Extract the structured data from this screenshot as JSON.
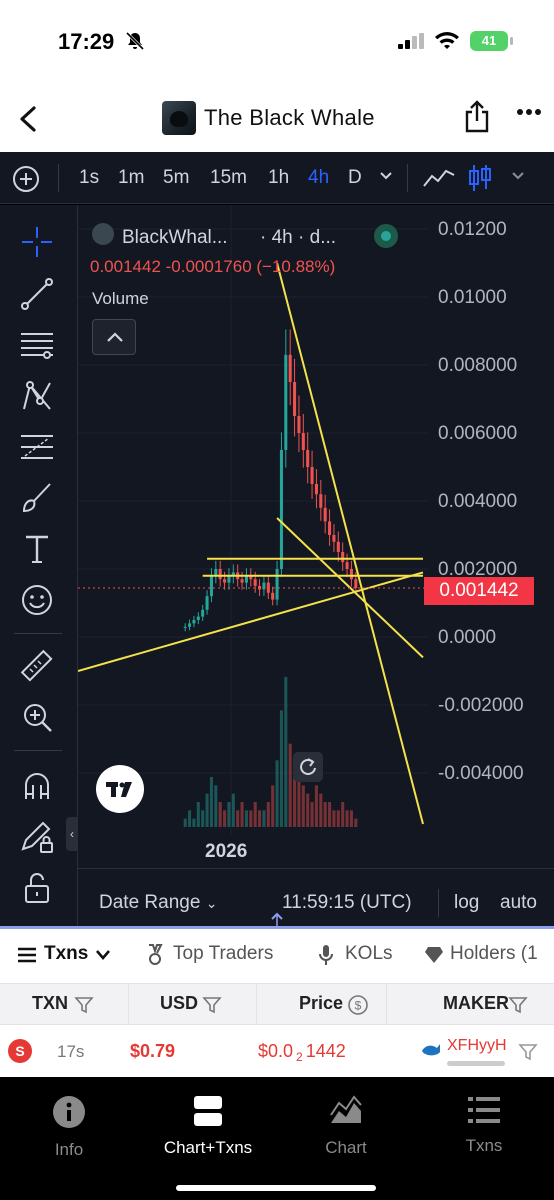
{
  "status_bar": {
    "time": "17:29",
    "battery": "41",
    "icons": [
      "bell-slash-icon",
      "cellular-signal-icon",
      "wifi-icon",
      "battery-icon"
    ]
  },
  "header": {
    "title": "The Black Whale",
    "icons": [
      "back-chevron-icon",
      "token-avatar",
      "share-icon",
      "more-dots-icon"
    ]
  },
  "toolbar": {
    "timeframes": [
      "1s",
      "1m",
      "5m",
      "15m",
      "1h",
      "4h",
      "D"
    ],
    "active_timeframe": "4h",
    "icons": [
      "add-circle-icon",
      "chevron-down-icon",
      "line-chart-icon",
      "candlestick-icon",
      "chevron-down-icon"
    ]
  },
  "drawing_tools": [
    "crosshair-icon",
    "trend-line-icon",
    "horizontal-lines-icon",
    "pattern-icon",
    "fib-icon",
    "brush-icon",
    "text-icon",
    "emoji-icon",
    "ruler-icon",
    "zoom-in-icon",
    "magnet-icon",
    "pencil-lock-icon",
    "lock-icon"
  ],
  "chart": {
    "legend_name": "BlackWhal...",
    "legend_meta": "· 4h · d...",
    "ohlc_line": "0.001442  -0.0001760  (−10.88%)",
    "volume_label": "Volume",
    "year_label": "2026",
    "current_price": "0.001442",
    "colors": {
      "up": "#26a69a",
      "down": "#ef5350",
      "drawing": "#f5e14a",
      "background": "#131722"
    }
  },
  "chart_data": {
    "type": "candlestick",
    "title": "BlackWhal...",
    "interval": "4h",
    "y_axis": {
      "ticks": [
        "0.01200",
        "0.01000",
        "0.008000",
        "0.006000",
        "0.004000",
        "0.002000",
        "0.0000",
        "-0.002000",
        "-0.004000"
      ],
      "ylim": [
        -0.0055,
        0.0126
      ]
    },
    "x_axis": {
      "ticks": [
        "2026"
      ]
    },
    "last_price": 0.001442,
    "change": -0.000176,
    "change_pct": -10.88,
    "series": [
      {
        "name": "price",
        "values": [
          0.0003,
          0.0004,
          0.0005,
          0.0006,
          0.0008,
          0.0012,
          0.0018,
          0.002,
          0.0017,
          0.0016,
          0.0018,
          0.0019,
          0.0017,
          0.0016,
          0.0018,
          0.0017,
          0.0015,
          0.0014,
          0.0016,
          0.0013,
          0.0011,
          0.002,
          0.0055,
          0.0083,
          0.0075,
          0.0065,
          0.006,
          0.0055,
          0.005,
          0.0045,
          0.0042,
          0.0038,
          0.0034,
          0.003,
          0.0028,
          0.0025,
          0.0022,
          0.002,
          0.0017,
          0.001442
        ]
      }
    ],
    "volume": [
      1,
      2,
      1,
      3,
      2,
      4,
      6,
      5,
      3,
      2,
      3,
      4,
      2,
      3,
      2,
      2,
      3,
      2,
      2,
      3,
      5,
      8,
      14,
      18,
      10,
      6,
      7,
      5,
      4,
      3,
      5,
      4,
      3,
      3,
      2,
      2,
      3,
      2,
      2,
      1
    ],
    "drawn_lines": [
      {
        "from": [
          0,
          -0.001
        ],
        "to": [
          40,
          0.0019
        ]
      },
      {
        "from": [
          6,
          0.0023
        ],
        "to": [
          40,
          0.0023
        ]
      },
      {
        "from": [
          5,
          0.0018
        ],
        "to": [
          40,
          0.0018
        ]
      },
      {
        "from": [
          22,
          0.011
        ],
        "to": [
          40,
          -0.0055
        ]
      },
      {
        "from": [
          22,
          0.0035
        ],
        "to": [
          40,
          -0.0006
        ]
      }
    ]
  },
  "chart_bottom": {
    "date_range": "Date Range",
    "clock": "11:59:15 (UTC)",
    "log": "log",
    "auto": "auto"
  },
  "tabs": [
    "Txns",
    "Top Traders",
    "KOLs",
    "Holders (1"
  ],
  "table": {
    "headers": [
      "TXN",
      "USD",
      "Price",
      "MAKER"
    ],
    "rows": [
      {
        "side": "S",
        "age": "17s",
        "usd": "$0.79",
        "price_prefix": "$0.0",
        "price_zeros": "2",
        "price_suffix": "1442",
        "maker": "XFHyyH"
      }
    ]
  },
  "bottom_nav": [
    {
      "label": "Info",
      "icon": "info-icon"
    },
    {
      "label": "Chart+Txns",
      "icon": "split-view-icon",
      "active": true
    },
    {
      "label": "Chart",
      "icon": "area-chart-icon"
    },
    {
      "label": "Txns",
      "icon": "list-icon"
    }
  ]
}
